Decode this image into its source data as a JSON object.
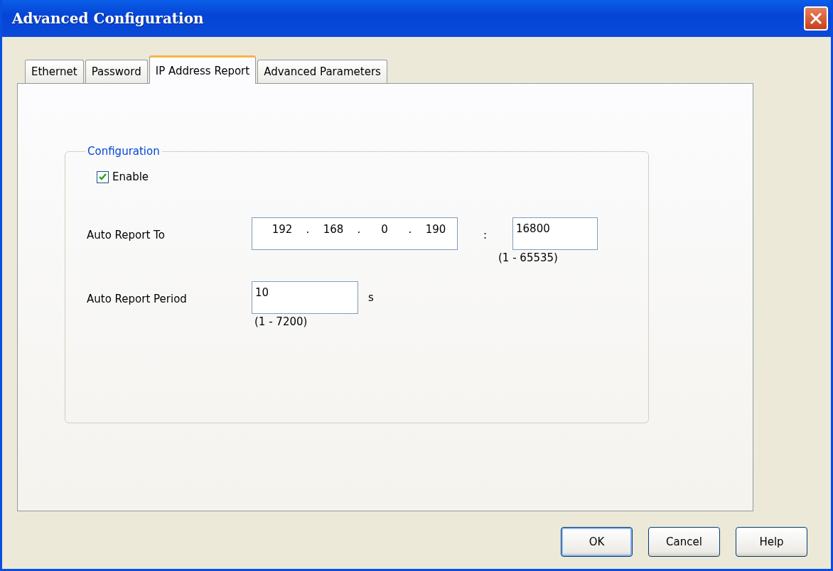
{
  "window": {
    "title": "Advanced Configuration"
  },
  "tabs": [
    {
      "label": "Ethernet",
      "selected": false
    },
    {
      "label": "Password",
      "selected": false
    },
    {
      "label": "IP Address Report",
      "selected": true
    },
    {
      "label": "Advanced Parameters",
      "selected": false
    }
  ],
  "group": {
    "title": "Configuration",
    "enable": {
      "label": "Enable",
      "checked": true
    },
    "auto_report_to": {
      "label": "Auto Report To",
      "ip_octets": [
        "192",
        "168",
        "0",
        "190"
      ],
      "octet_separator": ".",
      "port_separator": ":",
      "port": "16800",
      "port_range": "(1 - 65535)"
    },
    "auto_report_period": {
      "label": "Auto Report Period",
      "value": "10",
      "unit": "s",
      "range": "(1 - 7200)"
    }
  },
  "buttons": [
    {
      "label": "OK",
      "default": true
    },
    {
      "label": "Cancel",
      "default": false
    },
    {
      "label": "Help",
      "default": false
    }
  ]
}
